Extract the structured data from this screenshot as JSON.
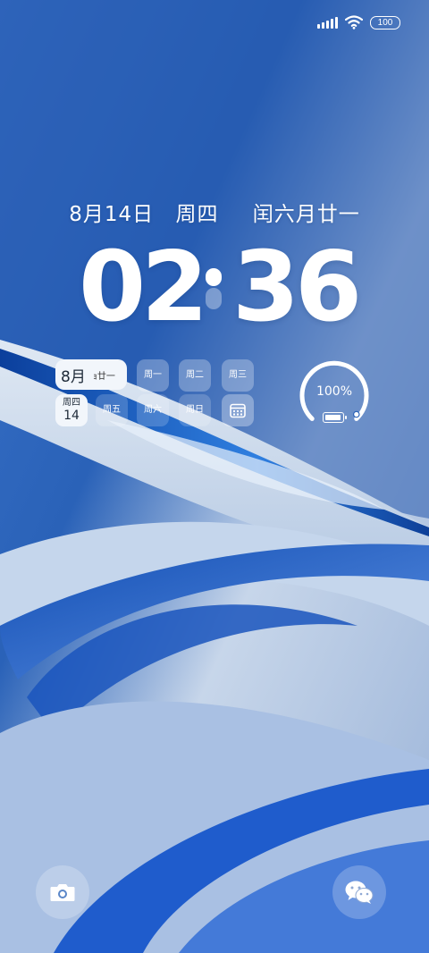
{
  "status_bar": {
    "signal_icon": "cellular-signal-icon",
    "wifi_icon": "wifi-icon",
    "battery_level": "100"
  },
  "date_line": {
    "date": "8月14日",
    "weekday": "周四",
    "lunar": "闰六月廿一"
  },
  "clock": {
    "h1": "0",
    "h2": "2",
    "m1": "3",
    "m2": "6"
  },
  "calendar_widget": {
    "month": "8月",
    "lunar_short": "ｮ廿一",
    "today_weekday": "周四",
    "today_day": "14",
    "weekdays": [
      "周一",
      "周二",
      "周三",
      "周五",
      "周六",
      "周日"
    ],
    "calendar_icon": "calendar-icon"
  },
  "battery_widget": {
    "percent_text": "100%",
    "level": 1.0,
    "icon": "battery-icon"
  },
  "shortcuts": {
    "camera_icon": "camera-icon",
    "wechat_icon": "wechat-icon"
  }
}
